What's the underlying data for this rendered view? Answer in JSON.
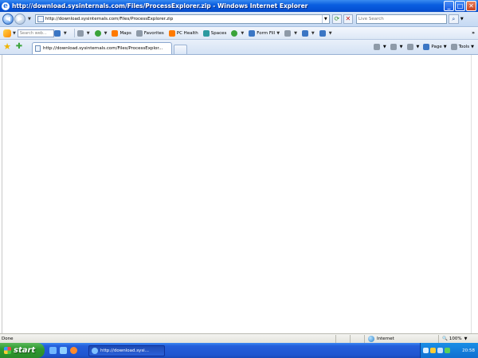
{
  "window": {
    "title": "http://download.sysinternals.com/Files/ProcessExplorer.zip - Windows Internet Explorer",
    "minimize": "_",
    "maximize": "□",
    "close": "✕"
  },
  "address_bar": {
    "url": "http://download.sysinternals.com/Files/ProcessExplorer.zip",
    "live_search_placeholder": "Live Search"
  },
  "live_toolbar": {
    "search_placeholder": "Search web...",
    "items": [
      {
        "label": "Maps",
        "icon": "maps-icon"
      },
      {
        "label": "Favorites",
        "icon": "favorites-icon"
      },
      {
        "label": "PC Health",
        "icon": "pc-health-icon"
      },
      {
        "label": "Spaces",
        "icon": "spaces-icon"
      },
      {
        "label": "Form Fill",
        "icon": "form-fill-icon"
      }
    ],
    "chevron": "»"
  },
  "tabs": [
    {
      "label": "http://download.sysinternals.com/Files/ProcessExplor...",
      "active": true
    }
  ],
  "command_bar": {
    "page_label": "Page",
    "tools_label": "Tools"
  },
  "status_bar": {
    "status": "Done",
    "zone": "Internet",
    "zoom": "100%"
  },
  "taskbar": {
    "start_label": "start",
    "task_button": "http://download.sysi...",
    "clock": "20:58"
  },
  "colors": {
    "titlebar": "#0a5ee0",
    "taskbar": "#245edb",
    "start": "#2f9a2f"
  }
}
